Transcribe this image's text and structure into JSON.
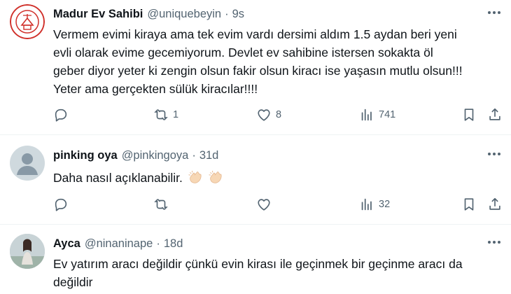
{
  "tweets": [
    {
      "name": "Madur Ev Sahibi",
      "handle": "@uniquebeyin",
      "time": "9s",
      "text_lines": [
        "Vermem evimi kiraya ama tek evim vardı dersimi aldım 1.5 aydan beri yeni",
        "evli olarak evime gecemiyorum. Devlet ev sahibine istersen sokakta öl",
        "geber diyor yeter ki zengin olsun fakir olsun kiracı ise yaşasın mutlu olsun!!!",
        "Yeter ama gerçekten sülük kiracılar!!!!"
      ],
      "avatar_logo_text": "EV SAHİPLERİ ADALET ARIYOR",
      "stats": {
        "replies": "",
        "retweets": "1",
        "likes": "8",
        "views": "741"
      }
    },
    {
      "name": "pinking oya",
      "handle": "@pinkingoya",
      "time": "31d",
      "text_lines": [
        "Daha nasıl açıklanabilir."
      ],
      "emoji": [
        "clapping-hands",
        "clapping-hands"
      ],
      "stats": {
        "replies": "",
        "retweets": "",
        "likes": "",
        "views": "32"
      }
    },
    {
      "name": "Ayca",
      "handle": "@ninaninape",
      "time": "18d",
      "text_lines": [
        "Ev yatırım aracı değildir çünkü evin kirası ile geçinmek bir geçinme aracı da",
        "değildir"
      ]
    }
  ],
  "separator": "·",
  "icons": [
    "more-icon",
    "reply-icon",
    "retweet-icon",
    "like-icon",
    "views-icon",
    "bookmark-icon",
    "share-icon"
  ],
  "colors": {
    "text": "#0f1419",
    "secondary": "#536471",
    "divider": "#eff3f4"
  }
}
